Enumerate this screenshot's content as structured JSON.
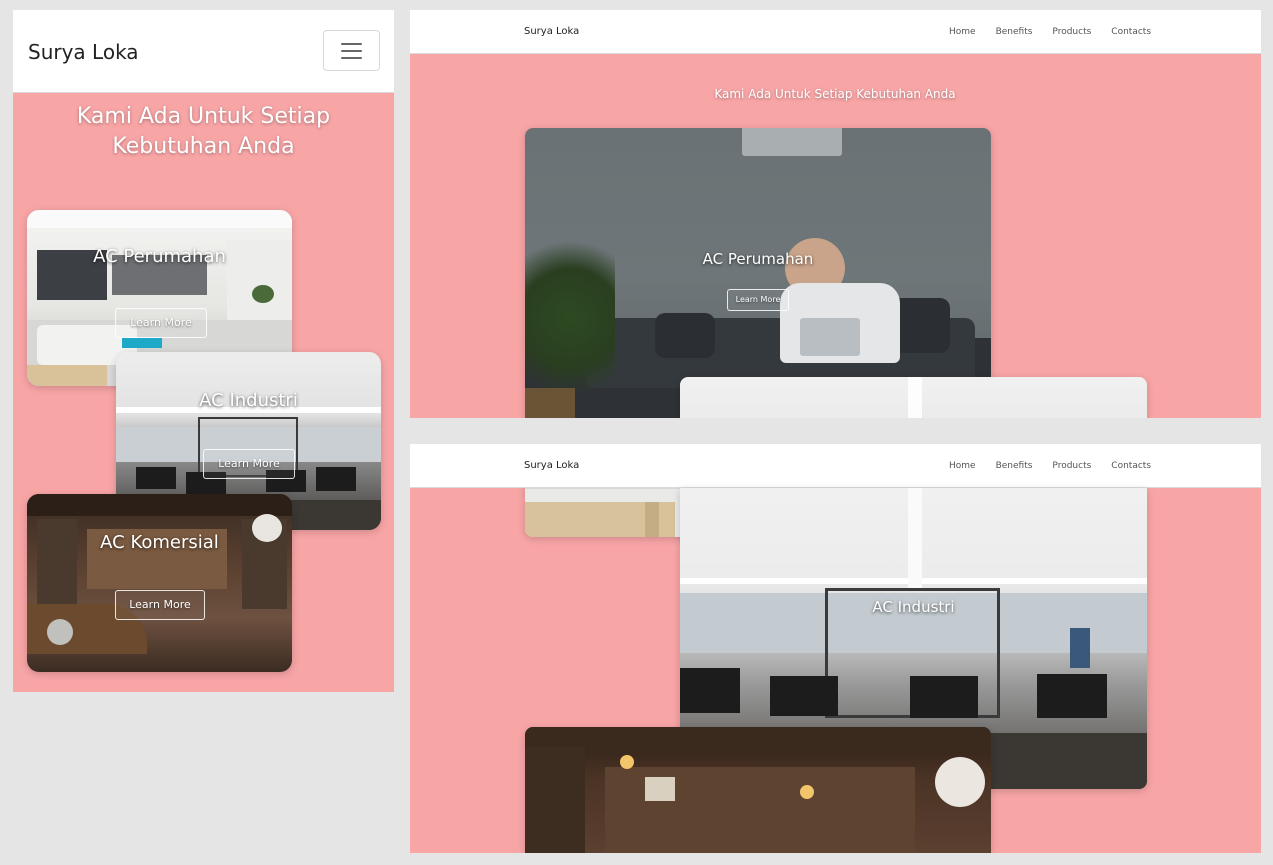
{
  "brand": "Surya Loka",
  "hero_title": "Kami Ada Untuk Setiap Kebutuhan Anda",
  "nav": [
    "Home",
    "Benefits",
    "Products",
    "Contacts"
  ],
  "cards": [
    {
      "title": "AC Perumahan",
      "button": "Learn More"
    },
    {
      "title": "AC Industri",
      "button": "Learn More"
    },
    {
      "title": "AC Komersial",
      "button": "Learn More"
    }
  ],
  "colors": {
    "hero_bg": "#f8a5a6",
    "page_bg": "#e5e5e5",
    "nav_bg": "#ffffff"
  }
}
